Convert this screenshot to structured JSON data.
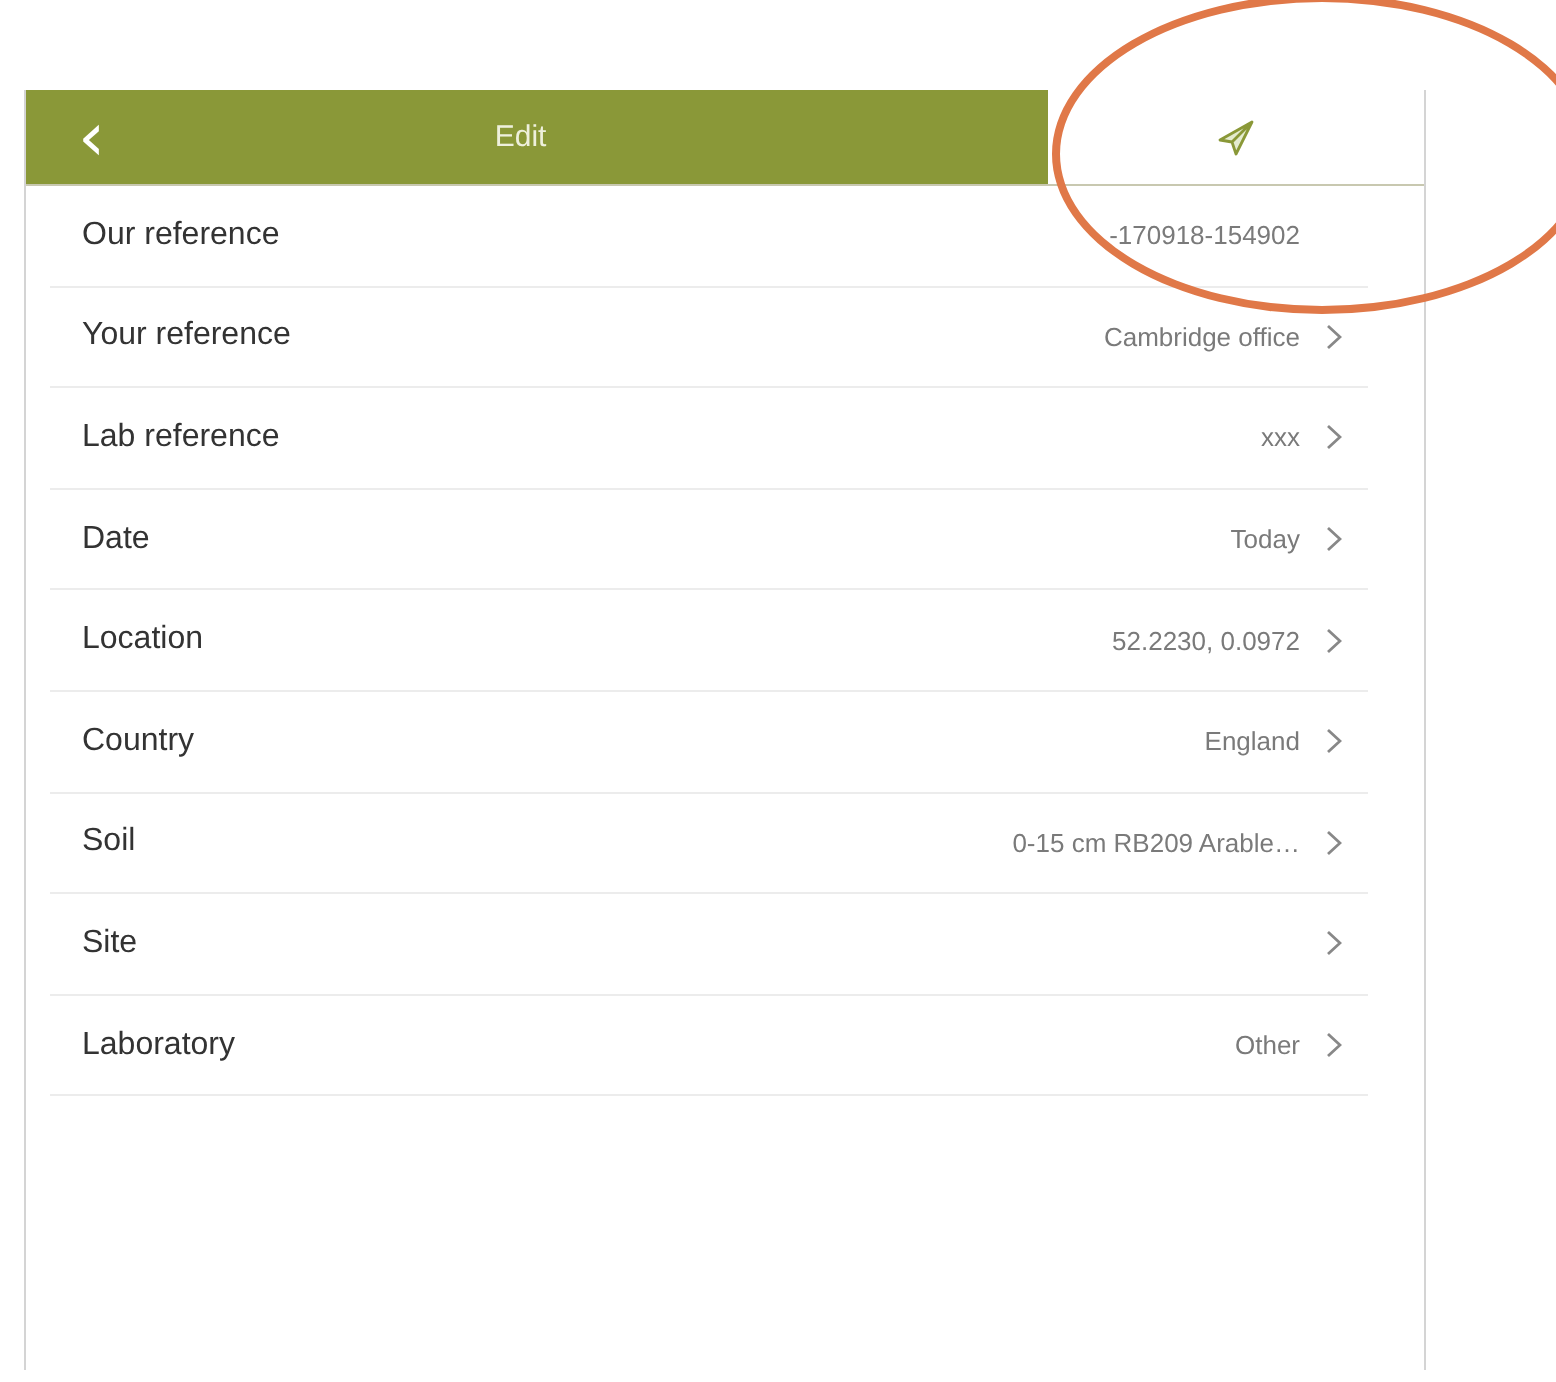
{
  "header": {
    "back": "‹",
    "title": "Edit"
  },
  "rows": [
    {
      "label": "Our reference",
      "value": "-170918-154902",
      "chevron": false
    },
    {
      "label": "Your reference",
      "value": "Cambridge office",
      "chevron": true
    },
    {
      "label": "Lab reference",
      "value": "xxx",
      "chevron": true
    },
    {
      "label": "Date",
      "value": "Today",
      "chevron": true
    },
    {
      "label": "Location",
      "value": "52.2230, 0.0972",
      "chevron": true
    },
    {
      "label": "Country",
      "value": "England",
      "chevron": true
    },
    {
      "label": "Soil",
      "value": "0-15 cm RB209 Arable…",
      "chevron": true
    },
    {
      "label": "Site",
      "value": "",
      "chevron": true
    },
    {
      "label": "Laboratory",
      "value": "Other",
      "chevron": true
    }
  ]
}
